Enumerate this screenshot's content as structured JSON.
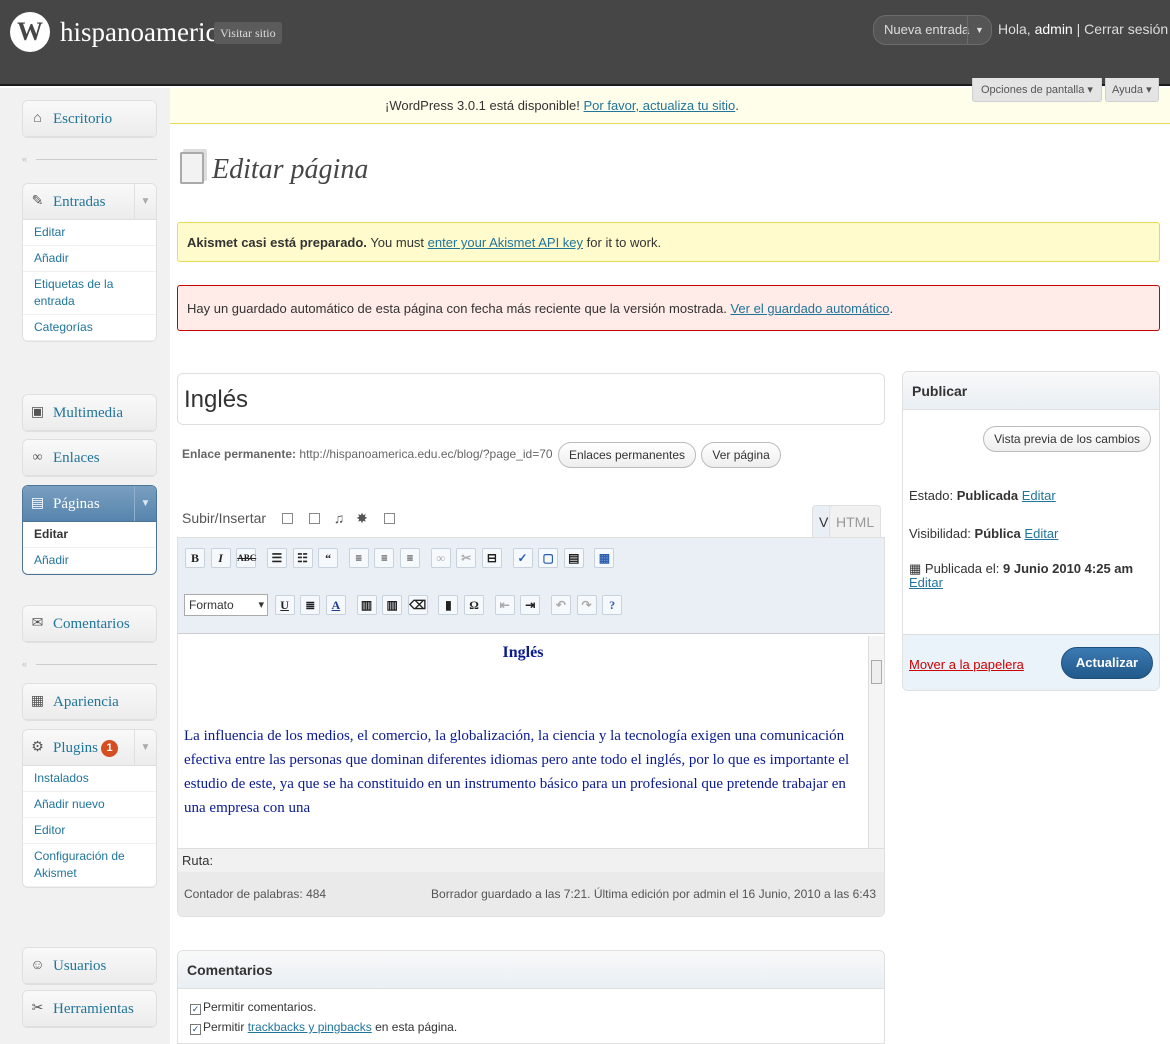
{
  "header": {
    "logo_glyph": "W",
    "site_name": "hispanoamerica",
    "visit_label": "Visitar sitio",
    "favorite_action": "Nueva entrada",
    "greeting": "Hola,",
    "user_name": "admin",
    "separator": "|",
    "logout": "Cerrar sesión"
  },
  "update_notice": {
    "text": "¡WordPress 3.0.1 está disponible!",
    "link": "Por favor, actualiza tu sitio",
    "end": "."
  },
  "screen_options": "Opciones de pantalla",
  "help": "Ayuda",
  "sidebar": {
    "dashboard": "Escritorio",
    "posts": {
      "label": "Entradas",
      "items": [
        "Editar",
        "Añadir",
        "Etiquetas de la entrada",
        "Categorías"
      ]
    },
    "media": "Multimedia",
    "links": "Enlaces",
    "pages": {
      "label": "Páginas",
      "items": [
        "Editar",
        "Añadir"
      ]
    },
    "comments": "Comentarios",
    "appearance": "Apariencia",
    "plugins": {
      "label": "Plugins",
      "badge": "1",
      "items": [
        "Instalados",
        "Añadir nuevo",
        "Editor",
        "Configuración de Akismet"
      ]
    },
    "users": "Usuarios",
    "tools": "Herramientas"
  },
  "page_title": "Editar página",
  "akismet": {
    "bold": "Akismet casi está preparado.",
    "text": "You must",
    "link": "enter your Akismet API key",
    "end": "for it to work."
  },
  "autosave": {
    "text": "Hay un guardado automático de esta página con fecha más reciente que la versión mostrada.",
    "link": "Ver el guardado automático",
    "end": "."
  },
  "post_title": "Inglés",
  "permalink": {
    "label": "Enlace permanente:",
    "url": "http://hispanoamerica.edu.ec/blog/?page_id=70",
    "btn1": "Enlaces permanentes",
    "btn2": "Ver página"
  },
  "editor": {
    "upload_label": "Subir/Insertar",
    "tab_visual": "Visual",
    "tab_html": "HTML",
    "format_select": "Formato",
    "content_heading": "Inglés",
    "content_text": "La influencia de los medios, el comercio, la globalización, la ciencia y la tecnología exigen una comunicación efectiva entre las personas que dominan diferentes idiomas pero ante todo el inglés, por lo que es importante el estudio de este, ya que se ha constituido en un instrumento básico para un profesional que pretende trabajar en una empresa con una",
    "path_label": "Ruta:",
    "word_count": "Contador de palabras: 484",
    "draft_status": "Borrador guardado a las 7:21. Última edición por admin el 16 Junio, 2010 a las 6:43"
  },
  "comments_box": {
    "title": "Comentarios",
    "allow_comments": "Permitir comentarios.",
    "allow_pings_prefix": "Permitir",
    "allow_pings_link": "trackbacks y pingbacks",
    "allow_pings_suffix": "en esta página."
  },
  "publish": {
    "title": "Publicar",
    "preview": "Vista previa de los cambios",
    "status_label": "Estado:",
    "status_value": "Publicada",
    "visibility_label": "Visibilidad:",
    "visibility_value": "Pública",
    "edit": "Editar",
    "published_label": "Publicada el:",
    "published_value": "9 Junio 2010 4:25 am",
    "trash": "Mover a la papelera",
    "update": "Actualizar"
  },
  "colors": {
    "header_bg": "#464646",
    "link": "#21759b",
    "active_menu": "#6a93b9",
    "notice_yellow": "#fffbcc",
    "notice_red": "#ffebe8",
    "primary_button": "#21598a",
    "content_text": "#0a1a8f"
  }
}
